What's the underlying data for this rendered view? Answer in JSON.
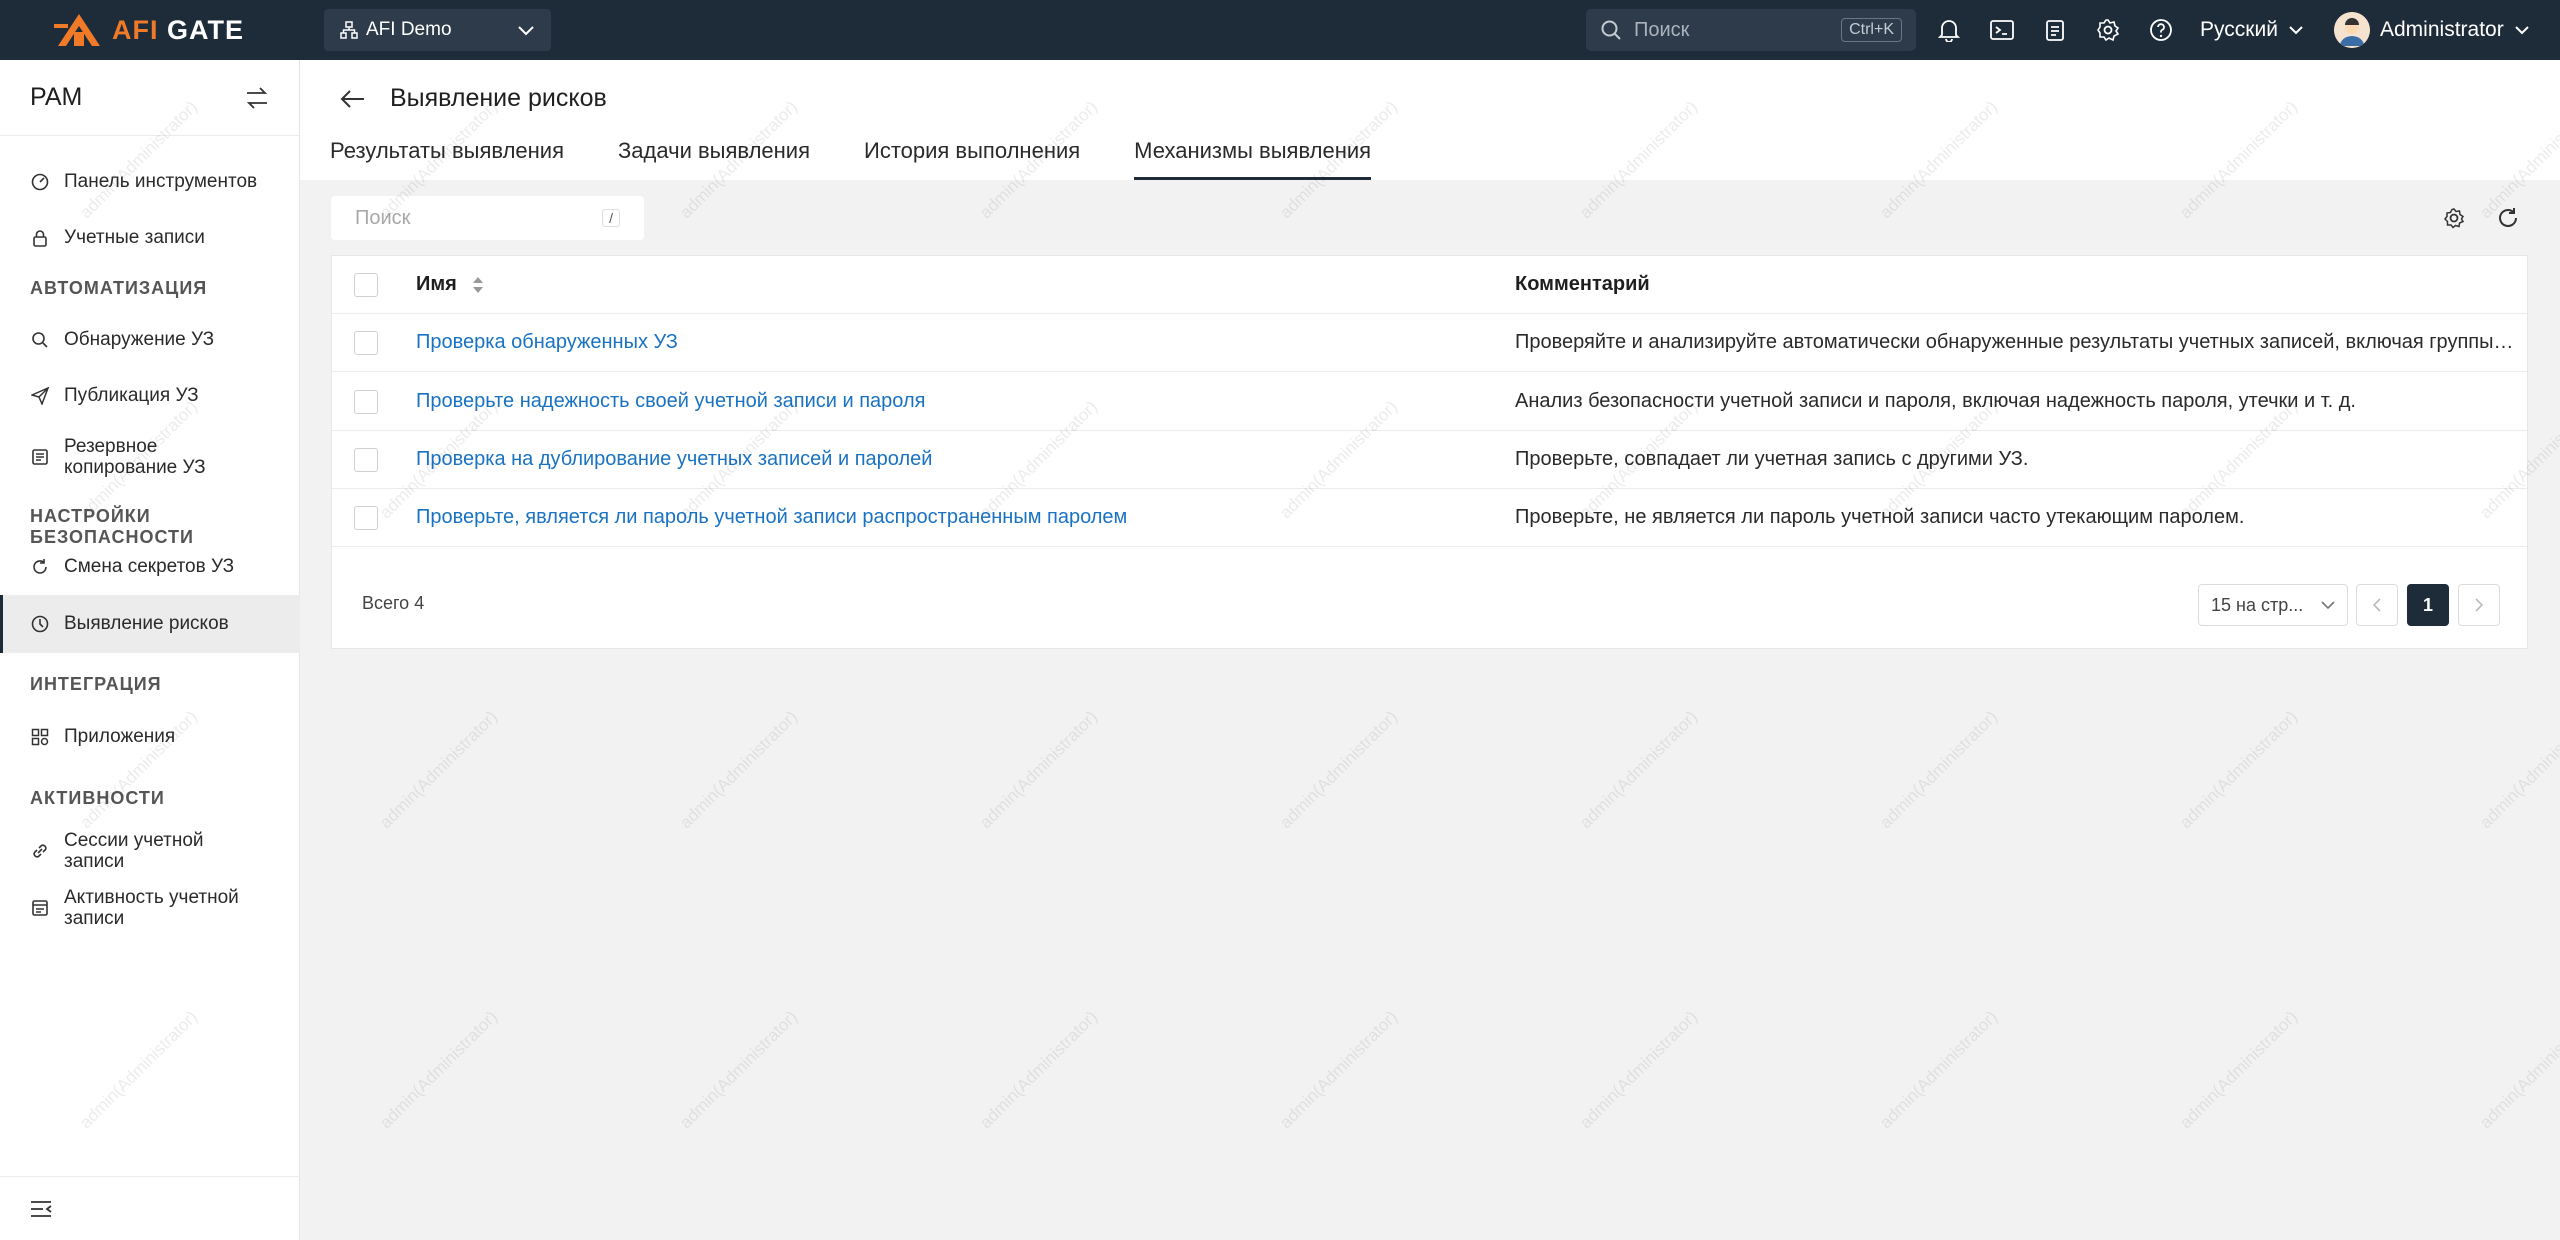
{
  "topbar": {
    "logo_text_a": "AFI",
    "logo_text_b": "GATE",
    "org": "AFI Demo",
    "search_placeholder": "Поиск",
    "search_shortcut": "Ctrl+K",
    "language": "Русский",
    "user": "Administrator",
    "colors": {
      "bg": "#1e2b38",
      "accent": "#f07a28"
    }
  },
  "sidebar": {
    "title": "PAM",
    "items_top": [
      {
        "label": "Панель инструментов",
        "icon": "dashboard-icon"
      },
      {
        "label": "Учетные записи",
        "icon": "lock-icon"
      }
    ],
    "section_automation": "АВТОМАТИЗАЦИЯ",
    "items_automation": [
      {
        "label": "Обнаружение УЗ",
        "icon": "search-icon"
      },
      {
        "label": "Публикация УЗ",
        "icon": "send-icon"
      },
      {
        "label_1": "Резервное",
        "label_2": "копирование УЗ",
        "icon": "backup-icon"
      }
    ],
    "section_security": "НАСТРОЙКИ БЕЗОПАСНОСТИ",
    "items_security": [
      {
        "label": "Смена секретов УЗ",
        "icon": "rotate-icon"
      },
      {
        "label": "Выявление рисков",
        "icon": "risk-icon"
      }
    ],
    "section_integration": "ИНТЕГРАЦИЯ",
    "items_integration": [
      {
        "label": "Приложения",
        "icon": "apps-icon"
      }
    ],
    "section_activity": "АКТИВНОСТИ",
    "items_activity": [
      {
        "label_1": "Сессии учетной",
        "label_2": "записи",
        "icon": "link-icon"
      },
      {
        "label_1": "Активность учетной",
        "label_2": "записи",
        "icon": "activity-icon"
      }
    ]
  },
  "page": {
    "title": "Выявление рисков",
    "tabs": [
      {
        "label": "Результаты выявления"
      },
      {
        "label": "Задачи выявления"
      },
      {
        "label": "История выполнения"
      },
      {
        "label": "Механизмы выявления"
      }
    ],
    "active_tab": "Механизмы выявления",
    "search_placeholder": "Поиск",
    "search_shortcut": "/"
  },
  "table": {
    "columns": {
      "name": "Имя",
      "comment": "Комментарий"
    },
    "rows": [
      {
        "name": "Проверка обнаруженных УЗ",
        "comment": "Проверяйте и анализируйте автоматически обнаруженные результаты учетных записей, включая группы и другие данные"
      },
      {
        "name": "Проверьте надежность своей учетной записи и пароля",
        "comment": "Анализ безопасности учетной записи и пароля, включая надежность пароля, утечки и т. д."
      },
      {
        "name": "Проверка на дублирование учетных записей и паролей",
        "comment": "Проверьте, совпадает ли учетная запись с другими УЗ."
      },
      {
        "name": "Проверьте, является ли пароль учетной записи распространенным паролем",
        "comment": "Проверьте, не является ли пароль учетной записи часто утекающим паролем."
      }
    ],
    "total": "Всего 4",
    "page_size": "15 на стр...",
    "current_page": "1"
  },
  "watermark": "admin(Administrator)"
}
